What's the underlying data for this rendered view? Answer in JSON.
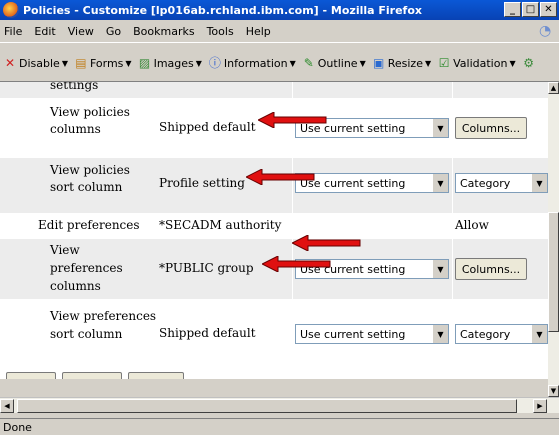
{
  "window": {
    "title": "Policies - Customize [lp016ab.rchland.ibm.com] - Mozilla Firefox"
  },
  "menu": [
    "File",
    "Edit",
    "View",
    "Go",
    "Bookmarks",
    "Tools",
    "Help"
  ],
  "toolbar": [
    "Disable",
    "Forms",
    "Images",
    "Information",
    "Outline",
    "Resize",
    "Validation"
  ],
  "rows": [
    {
      "name": "settings",
      "value": "",
      "select": "",
      "action": ""
    },
    {
      "name": "View policies columns",
      "value": "Shipped default",
      "select": "Use current setting",
      "action": "Columns..."
    },
    {
      "name": "View policies sort column",
      "value": "Profile setting",
      "select": "Use current setting",
      "action": "Category"
    },
    {
      "name": "Edit preferences",
      "value": "*SECADM authority",
      "select": "",
      "action": "Allow"
    },
    {
      "name": "View preferences columns",
      "value": "*PUBLIC group",
      "select": "Use current setting",
      "action": "Columns..."
    },
    {
      "name": "View preferences sort column",
      "value": "Shipped default",
      "select": "Use current setting",
      "action": "Category"
    }
  ],
  "status": "Done",
  "colors": {
    "arrow": "#e01010",
    "titlebar": "#0a58d6",
    "row_shade": "#ececec"
  }
}
